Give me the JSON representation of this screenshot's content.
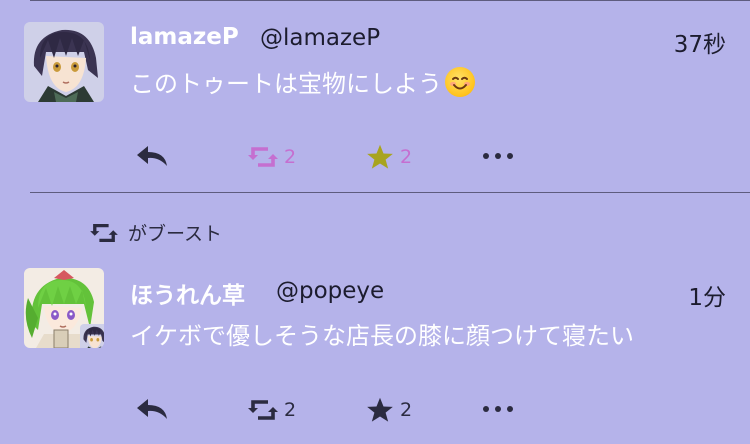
{
  "posts": [
    {
      "display_name": "lamazeP",
      "handle": "@lamazeP",
      "time": "37秒",
      "content": "このトゥートは宝物にしよう",
      "emoji": "smiling-face-emoji",
      "boost_count": "2",
      "fav_count": "2",
      "boosted": true,
      "favourited": true,
      "colors": {
        "boost": "#c56fd0",
        "fav": "#a8a41e",
        "fav_count": "#c56fd0"
      }
    },
    {
      "boost_label": "がブースト",
      "display_name": "ほうれん草",
      "handle": "@popeye",
      "time": "1分",
      "content": "イケボで優しそうな店長の膝に顔つけて寝たい",
      "boost_count": "2",
      "fav_count": "2",
      "boosted": false,
      "favourited": false
    }
  ],
  "theme": {
    "background": "#b5b3ea",
    "icon": "#2b2b40",
    "name": "#ffffff"
  }
}
